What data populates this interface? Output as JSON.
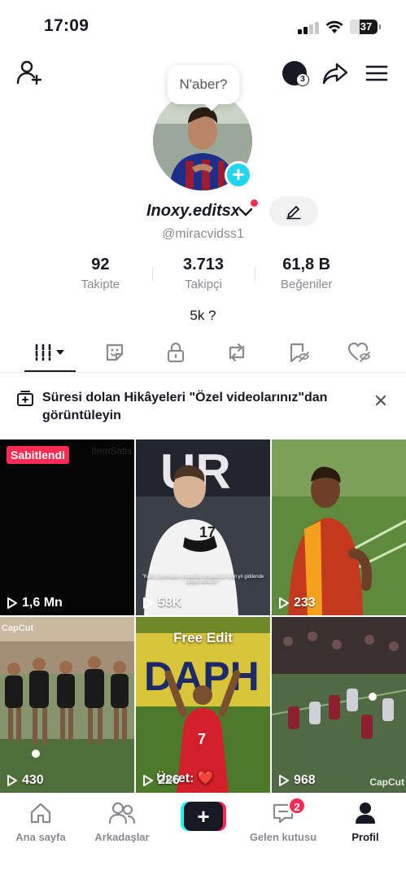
{
  "status_bar": {
    "time": "17:09",
    "battery": "37",
    "battery_level_percent": 37
  },
  "profile": {
    "note_bubble": "N'aber?",
    "display_name": "Inoxy.editsx",
    "handle": "@miracvidss1",
    "bio": "5k ?",
    "coins_badge": "3"
  },
  "stats": [
    {
      "value": "92",
      "label": "Takipte"
    },
    {
      "value": "3.713",
      "label": "Takipçi"
    },
    {
      "value": "61,8 B",
      "label": "Beğeniler"
    }
  ],
  "tabs": [
    {
      "name": "videos",
      "icon": "grid-bars-icon",
      "active": true
    },
    {
      "name": "stickers",
      "icon": "sticker-icon"
    },
    {
      "name": "private",
      "icon": "lock-icon"
    },
    {
      "name": "reposts",
      "icon": "repost-icon"
    },
    {
      "name": "favorites",
      "icon": "bookmark-hidden-icon"
    },
    {
      "name": "liked",
      "icon": "heart-hidden-icon"
    }
  ],
  "notice": {
    "text": "Süresi dolan Hikâyeleri \"Özel videolarınız\"dan görüntüleyin"
  },
  "videos": [
    {
      "views": "1,6 Mn",
      "pinned_label": "Sabitlendi",
      "bg": "#050505"
    },
    {
      "views": "58K",
      "caption": "\"Kalbi çarpmadan yaşamak olmayacak olan yıl gidilende gölge olmasın\"",
      "bg": "#3b3f4a"
    },
    {
      "views": "233",
      "bg": "#5a7a40"
    },
    {
      "views": "430",
      "watermark": "CapCut",
      "bg": "#7c8a6a"
    },
    {
      "views": "226",
      "overlay_top": "Free Edit",
      "overlay_bottom": "Ücret: ❤️",
      "bg": "#6f8a2a"
    },
    {
      "views": "968",
      "watermark": "CapCut",
      "bg": "#4f6a44"
    }
  ],
  "bottom_nav": [
    {
      "label": "Ana sayfa",
      "icon": "home-icon"
    },
    {
      "label": "Arkadaşlar",
      "icon": "friends-icon"
    },
    {
      "label": "",
      "icon": "plus-icon"
    },
    {
      "label": "Gelen kutusu",
      "icon": "inbox-icon",
      "badge": "2"
    },
    {
      "label": "Profil",
      "icon": "profile-icon",
      "active": true
    }
  ],
  "colors": {
    "accent": "#fe2c55",
    "cyan": "#20d5ec",
    "text": "#161823",
    "muted": "#8a8b91"
  }
}
